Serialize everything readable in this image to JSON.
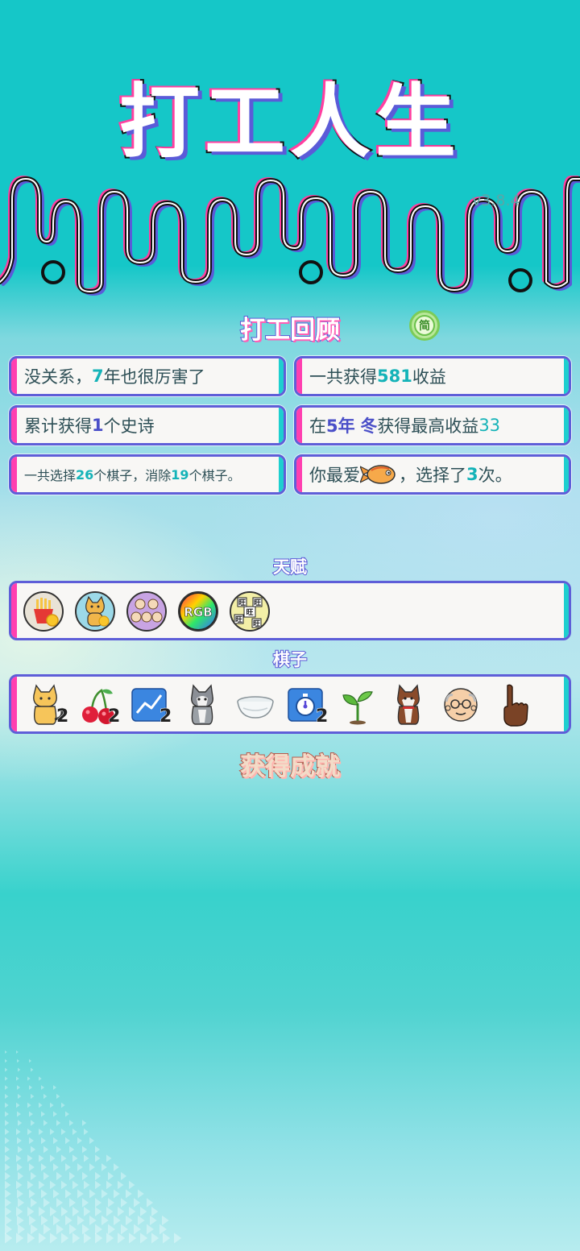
{
  "game_title": "打工人生",
  "version": "v3.8.4",
  "lang_button": "简",
  "review": {
    "title": "打工回顾",
    "cards": [
      {
        "pre": "没关系，",
        "num": "7",
        "post": "年也很厉害了"
      },
      {
        "pre": "一共获得",
        "num": "581",
        "post": "收益"
      },
      {
        "pre": "累计获得",
        "num": "1",
        "post": "个史诗"
      },
      {
        "pre": "在 ",
        "year": "5年",
        "season": "冬",
        "mid": " 获得最高收益",
        "num": "33"
      },
      {
        "a": "一共选择",
        "n1": "26",
        "b": "个棋子，消除",
        "n2": "19",
        "c": "个棋子。"
      },
      {
        "pre": "你最爱",
        "icon": "fish-icon",
        "mid": "，选择了",
        "num": "3",
        "post": "次。"
      }
    ]
  },
  "talents": {
    "title": "天赋",
    "items": [
      {
        "icon": "french-fries-coin-icon"
      },
      {
        "icon": "cat-coin-icon"
      },
      {
        "icon": "hamsters-icon"
      },
      {
        "icon": "rgb-icon",
        "text": "RGB"
      },
      {
        "icon": "wang-tiles-icon",
        "text": "旺"
      }
    ]
  },
  "pieces": {
    "title": "棋子",
    "items": [
      {
        "icon": "cat-icon",
        "count": "2"
      },
      {
        "icon": "cherry-icon",
        "count": "2"
      },
      {
        "icon": "stock-chart-icon",
        "count": "2"
      },
      {
        "icon": "husky-icon",
        "count": ""
      },
      {
        "icon": "bowl-icon",
        "count": ""
      },
      {
        "icon": "stopwatch-icon",
        "count": "2"
      },
      {
        "icon": "sprout-icon",
        "count": ""
      },
      {
        "icon": "shiba-dog-icon",
        "count": ""
      },
      {
        "icon": "old-man-icon",
        "count": ""
      },
      {
        "icon": "pointing-finger-icon",
        "count": ""
      }
    ]
  },
  "achievements": {
    "title": "获得成就"
  },
  "colors": {
    "teal": "#15c7c8",
    "purple": "#5e5ed8",
    "pink": "#ff3fb0",
    "highlight": "#15b3b8"
  }
}
